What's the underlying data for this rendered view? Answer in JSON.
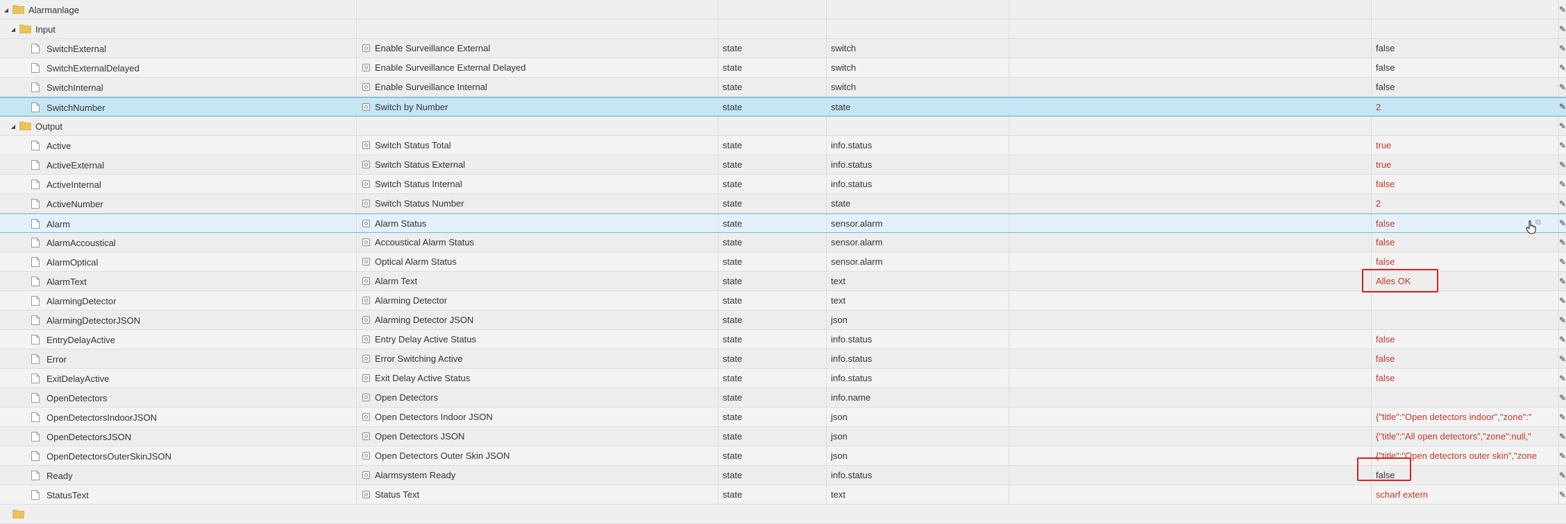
{
  "root": {
    "label": "Alarmanlage"
  },
  "groups": [
    {
      "label": "Input",
      "rows": [
        {
          "name": "SwitchExternal",
          "title": "Enable Surveillance External",
          "role": "state",
          "type": "switch",
          "value": "false",
          "value_red": false
        },
        {
          "name": "SwitchExternalDelayed",
          "title": "Enable Surveillance External Delayed",
          "role": "state",
          "type": "switch",
          "value": "false",
          "value_red": false
        },
        {
          "name": "SwitchInternal",
          "title": "Enable Surveillance Internal",
          "role": "state",
          "type": "switch",
          "value": "false",
          "value_red": false
        },
        {
          "name": "SwitchNumber",
          "title": "Switch by Number",
          "role": "state",
          "type": "state",
          "value": "2",
          "value_red": true,
          "selected": true
        }
      ]
    },
    {
      "label": "Output",
      "rows": [
        {
          "name": "Active",
          "title": "Switch Status Total",
          "role": "state",
          "type": "info.status",
          "value": "true",
          "value_red": true
        },
        {
          "name": "ActiveExternal",
          "title": "Switch Status External",
          "role": "state",
          "type": "info.status",
          "value": "true",
          "value_red": true
        },
        {
          "name": "ActiveInternal",
          "title": "Switch Status Internal",
          "role": "state",
          "type": "info.status",
          "value": "false",
          "value_red": true
        },
        {
          "name": "ActiveNumber",
          "title": "Switch Status Number",
          "role": "state",
          "type": "state",
          "value": "2",
          "value_red": true
        },
        {
          "name": "Alarm",
          "title": "Alarm Status",
          "role": "state",
          "type": "sensor.alarm",
          "value": "false",
          "value_red": true,
          "hover": true
        },
        {
          "name": "AlarmAccoustical",
          "title": "Accoustical Alarm Status",
          "role": "state",
          "type": "sensor.alarm",
          "value": "false",
          "value_red": true
        },
        {
          "name": "AlarmOptical",
          "title": "Optical Alarm Status",
          "role": "state",
          "type": "sensor.alarm",
          "value": "false",
          "value_red": true
        },
        {
          "name": "AlarmText",
          "title": "Alarm Text",
          "role": "state",
          "type": "text",
          "value": "Alles OK",
          "value_red": true
        },
        {
          "name": "AlarmingDetector",
          "title": "Alarming Detector",
          "role": "state",
          "type": "text",
          "value": "",
          "value_red": true
        },
        {
          "name": "AlarmingDetectorJSON",
          "title": "Alarming Detector JSON",
          "role": "state",
          "type": "json",
          "value": "",
          "value_red": true
        },
        {
          "name": "EntryDelayActive",
          "title": "Entry Delay Active Status",
          "role": "state",
          "type": "info.status",
          "value": "false",
          "value_red": true
        },
        {
          "name": "Error",
          "title": "Error Switching Active",
          "role": "state",
          "type": "info.status",
          "value": "false",
          "value_red": true
        },
        {
          "name": "ExitDelayActive",
          "title": "Exit Delay Active Status",
          "role": "state",
          "type": "info.status",
          "value": "false",
          "value_red": true
        },
        {
          "name": "OpenDetectors",
          "title": "Open Detectors",
          "role": "state",
          "type": "info.name",
          "value": "",
          "value_red": true
        },
        {
          "name": "OpenDetectorsIndoorJSON",
          "title": "Open Detectors Indoor JSON",
          "role": "state",
          "type": "json",
          "value": "{\"title\":\"Open detectors indoor\",\"zone\":\"",
          "value_red": true
        },
        {
          "name": "OpenDetectorsJSON",
          "title": "Open Detectors JSON",
          "role": "state",
          "type": "json",
          "value": "{\"title\":\"All open detectors\",\"zone\":null,\"",
          "value_red": true
        },
        {
          "name": "OpenDetectorsOuterSkinJSON",
          "title": "Open Detectors Outer Skin JSON",
          "role": "state",
          "type": "json",
          "value": "{\"title\":\"Open detectors outer skin\",\"zone",
          "value_red": true
        },
        {
          "name": "Ready",
          "title": "Alarmsystem Ready",
          "role": "state",
          "type": "info.status",
          "value": "false",
          "value_red": false
        },
        {
          "name": "StatusText",
          "title": "Status Text",
          "role": "state",
          "type": "text",
          "value": "scharf extern",
          "value_red": true
        }
      ]
    }
  ],
  "icons": {
    "expander": "triangle-down-icon",
    "folder": "folder-icon",
    "file": "file-icon",
    "state": "state-object-icon",
    "edit": "pencil-icon",
    "copy": "copy-icon",
    "cursor": "hand-cursor-icon"
  },
  "colors": {
    "value_red": "#c0392b",
    "highlight_box": "#d42020",
    "selected_row": "#c6e6f5",
    "folder_yellow": "#e8c45a"
  }
}
